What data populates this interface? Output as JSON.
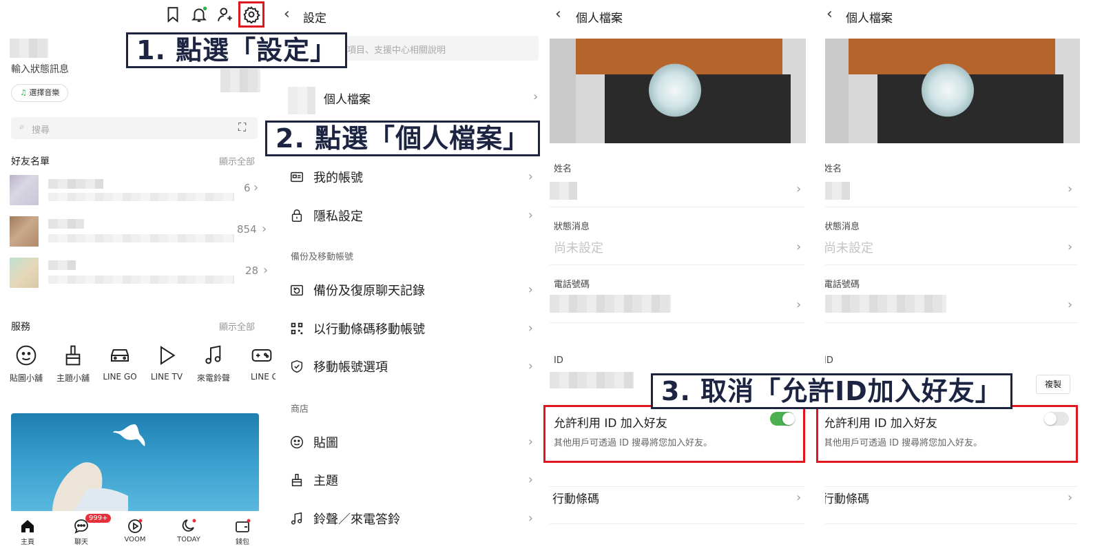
{
  "home": {
    "status_placeholder": "輸入狀態訊息",
    "music_button": "選擇音樂",
    "search_placeholder": "搜尋",
    "friends_header": "好友名單",
    "show_all": "顯示全部",
    "friend_counts": [
      "6",
      "854",
      "28"
    ],
    "services_header": "服務",
    "services_show_all": "顯示全部",
    "services": [
      {
        "label": "貼圖小舖",
        "icon": "smiley-icon"
      },
      {
        "label": "主題小舖",
        "icon": "brush-icon"
      },
      {
        "label": "LINE GO",
        "icon": "car-icon"
      },
      {
        "label": "LINE TV",
        "icon": "play-icon"
      },
      {
        "label": "來電鈴聲",
        "icon": "music-note-icon"
      },
      {
        "label": "LINE GAMI",
        "icon": "game-icon"
      }
    ],
    "nav": [
      {
        "label": "主頁"
      },
      {
        "label": "聊天",
        "badge": "999+"
      },
      {
        "label": "VOOM"
      },
      {
        "label": "TODAY"
      },
      {
        "label": "錢包"
      }
    ]
  },
  "settings": {
    "title": "設定",
    "search_placeholder": "設定項目、支援中心相關說明",
    "profile_item": "個人檔案",
    "items_top": [
      {
        "label": "我的帳號",
        "icon": "id-card-icon"
      },
      {
        "label": "隱私設定",
        "icon": "lock-icon"
      }
    ],
    "section_backup": "備份及移動帳號",
    "items_backup": [
      {
        "label": "備份及復原聊天記錄",
        "icon": "backup-icon"
      },
      {
        "label": "以行動條碼移動帳號",
        "icon": "qr-code-icon"
      },
      {
        "label": "移動帳號選項",
        "icon": "shield-icon"
      }
    ],
    "section_store": "商店",
    "items_store": [
      {
        "label": "貼圖",
        "icon": "smiley-icon"
      },
      {
        "label": "主題",
        "icon": "brush-icon"
      },
      {
        "label": "鈴聲／來電答鈴",
        "icon": "music-note-icon"
      }
    ]
  },
  "profile": {
    "title": "個人檔案",
    "name_label": "姓名",
    "status_label": "狀態消息",
    "status_value": "尚未設定",
    "phone_label": "電話號碼",
    "id_label": "ID",
    "copy_button": "複製",
    "allow_id_title": "允許利用 ID 加入好友",
    "allow_id_desc": "其他用戶可透過 ID 搜尋將您加入好友。",
    "qr_label": "行動條碼",
    "toggle_before": true,
    "toggle_after": false
  },
  "annotations": {
    "step1": "1. 點選「設定」",
    "step2": "2. 點選「個人檔案」",
    "step3": "3. 取消「允許ID加入好友」"
  },
  "colors": {
    "toggle_on": "#4cb050",
    "badge_red": "#e5303a",
    "annotation_navy": "#1c2442",
    "highlight_red": "#e0161c"
  }
}
